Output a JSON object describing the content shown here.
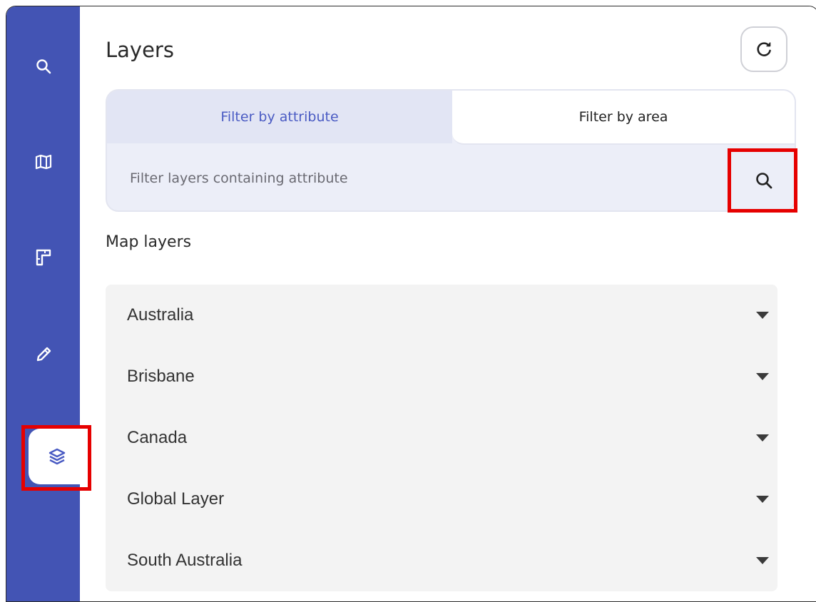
{
  "panel": {
    "title": "Layers"
  },
  "rail": {
    "items": [
      {
        "name": "search",
        "icon": "search-icon"
      },
      {
        "name": "map",
        "icon": "map-icon"
      },
      {
        "name": "measure",
        "icon": "ruler-icon"
      },
      {
        "name": "draw",
        "icon": "pencil-icon"
      },
      {
        "name": "layers",
        "icon": "layers-icon",
        "active": true
      }
    ]
  },
  "filter": {
    "tabs": [
      {
        "label": "Filter by attribute",
        "active": true
      },
      {
        "label": "Filter by area",
        "active": false
      }
    ],
    "placeholder": "Filter layers containing attribute",
    "value": ""
  },
  "map_layers": {
    "section_label": "Map layers",
    "items": [
      {
        "label": "Australia"
      },
      {
        "label": "Brisbane"
      },
      {
        "label": "Canada"
      },
      {
        "label": "Global Layer"
      },
      {
        "label": "South Australia"
      }
    ]
  },
  "colors": {
    "rail_bg": "#4354b4",
    "accent": "#4a5bc3",
    "highlight": "#e60000",
    "list_bg": "#f3f3f3"
  },
  "icons": {
    "refresh": "refresh-icon",
    "search": "search-icon",
    "caret": "caret-down-icon"
  }
}
